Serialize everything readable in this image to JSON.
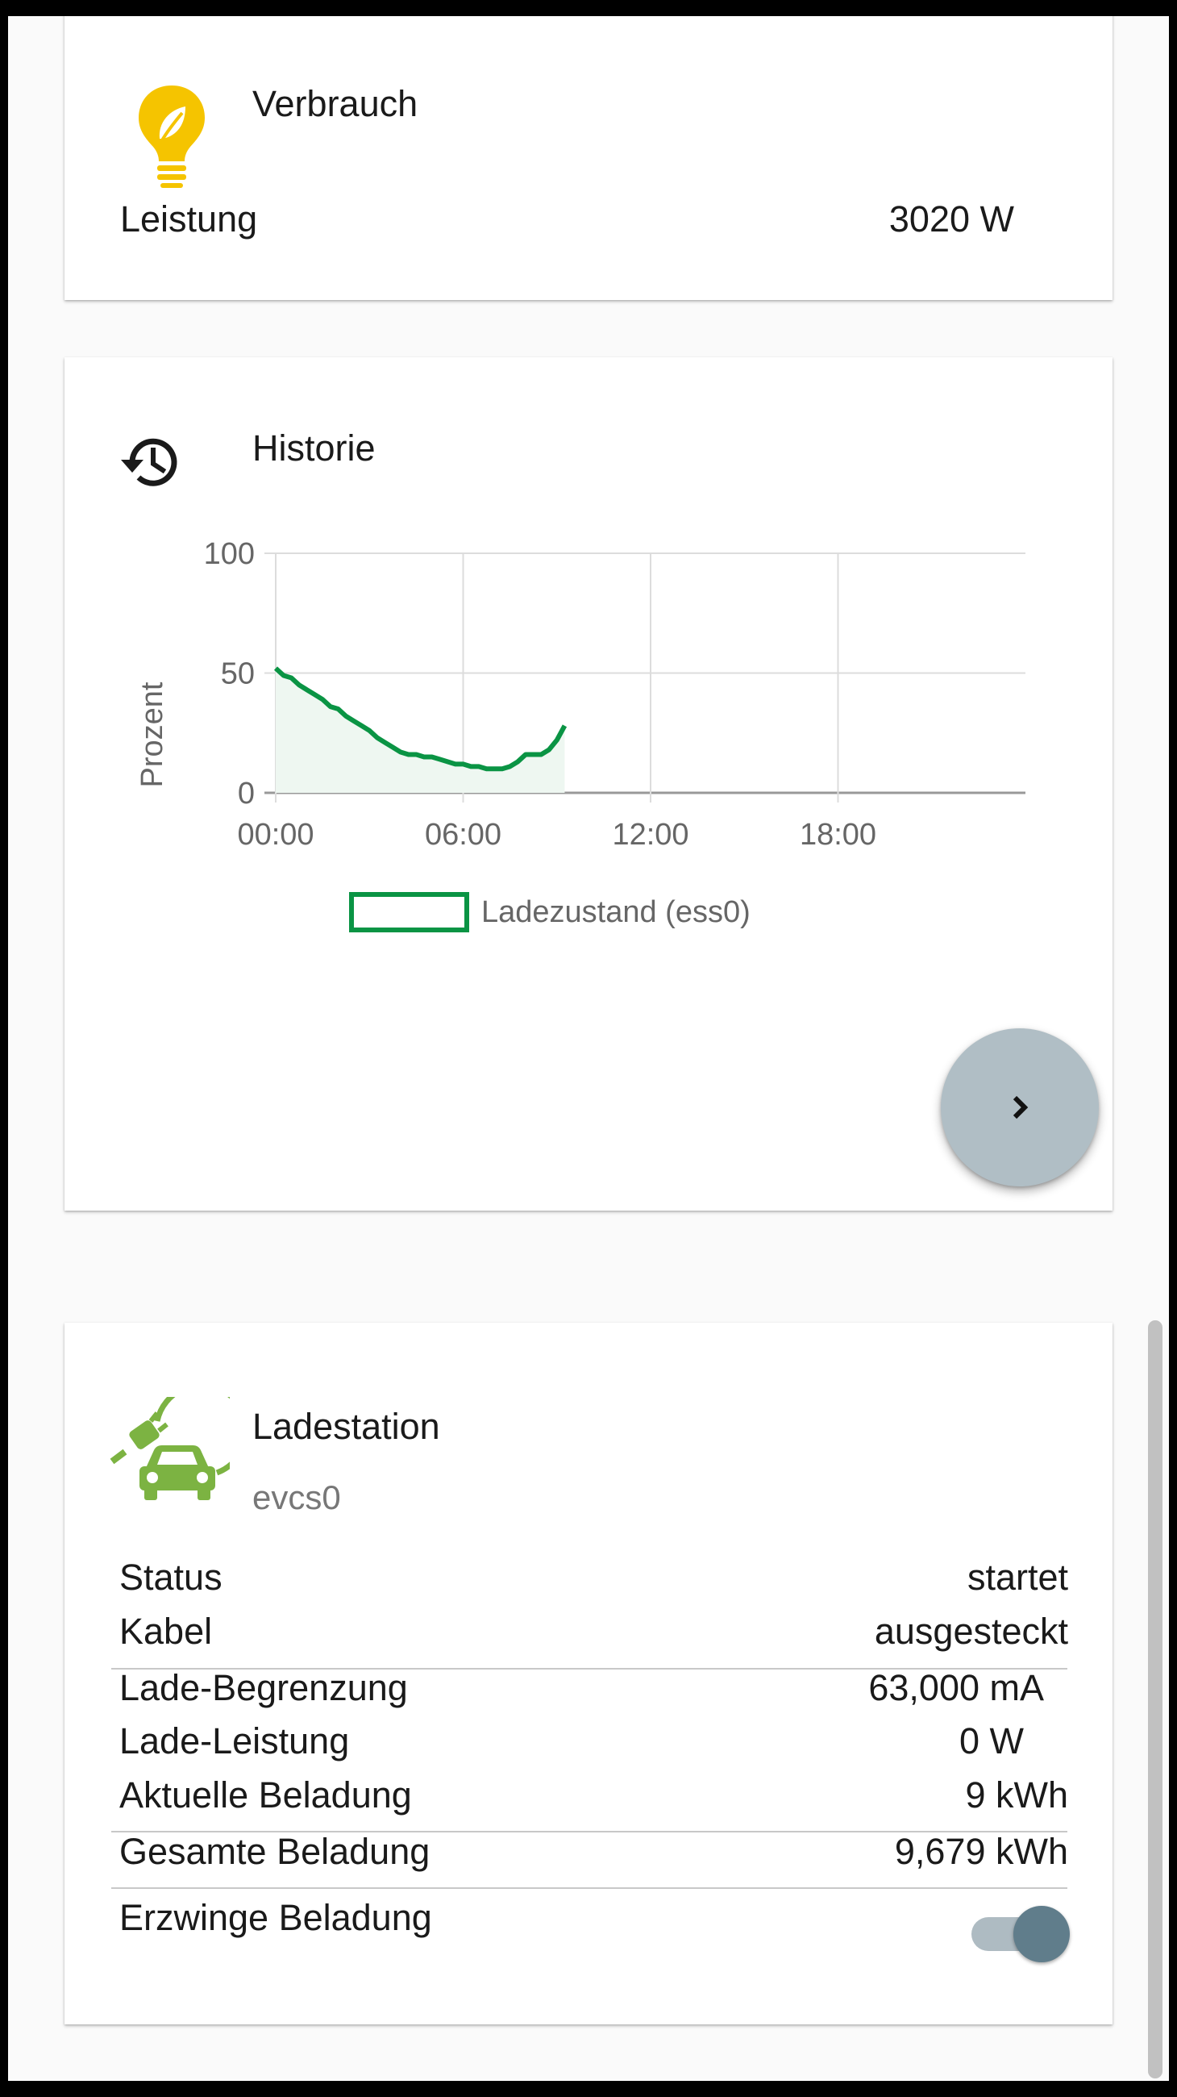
{
  "consumption": {
    "title": "Verbrauch",
    "icon": "lightbulb-leaf-icon",
    "icon_color": "#f5c400",
    "power_label": "Leistung",
    "power_value": "3020 W"
  },
  "history": {
    "title": "Historie",
    "icon": "history-icon",
    "fab_icon": "chevron-right-icon",
    "fab_color": "#b0bec5"
  },
  "chart_data": {
    "type": "area",
    "ylabel": "Prozent",
    "ylim": [
      0,
      100
    ],
    "yticks": [
      "100",
      "50",
      "0"
    ],
    "xlim": [
      0,
      24
    ],
    "xticks": [
      "00:00",
      "06:00",
      "12:00",
      "18:00"
    ],
    "series": [
      {
        "name": "Ladezustand (ess0)",
        "color": "#0a9444",
        "fill": "#eef7f1",
        "x": [
          0,
          0.25,
          0.5,
          0.75,
          1.0,
          1.25,
          1.5,
          1.75,
          2.0,
          2.25,
          2.5,
          2.75,
          3.0,
          3.25,
          3.5,
          3.75,
          4.0,
          4.25,
          4.5,
          4.75,
          5.0,
          5.25,
          5.5,
          5.75,
          6.0,
          6.25,
          6.5,
          6.75,
          7.0,
          7.25,
          7.5,
          7.75,
          8.0,
          8.25,
          8.5,
          8.75,
          9.0,
          9.25
        ],
        "values": [
          52,
          49,
          48,
          45,
          43,
          41,
          39,
          36,
          35,
          32,
          30,
          28,
          26,
          23,
          21,
          19,
          17,
          16,
          16,
          15,
          15,
          14,
          13,
          12,
          12,
          11,
          11,
          10,
          10,
          10,
          11,
          13,
          16,
          16,
          16,
          18,
          22,
          28
        ]
      }
    ],
    "grid": true,
    "legend": "bottom-center"
  },
  "evcs": {
    "title": "Ladestation",
    "subtitle": "evcs0",
    "icon": "ev-charging-car-icon",
    "icon_color": "#7cb342",
    "rows": [
      {
        "label": "Status",
        "value": "startet"
      },
      {
        "label": "Kabel",
        "value": "ausgesteckt"
      },
      {
        "label": "Lade-Begrenzung",
        "value": "63,000 mA"
      },
      {
        "label": "Lade-Leistung",
        "value": "0 W"
      },
      {
        "label": "Aktuelle Beladung",
        "value": "9 kWh"
      },
      {
        "label": "Gesamte Beladung",
        "value": "9,679 kWh"
      }
    ],
    "force_label": "Erzwinge Beladung",
    "force_enabled": true,
    "toggle_color": "#607d8b"
  }
}
